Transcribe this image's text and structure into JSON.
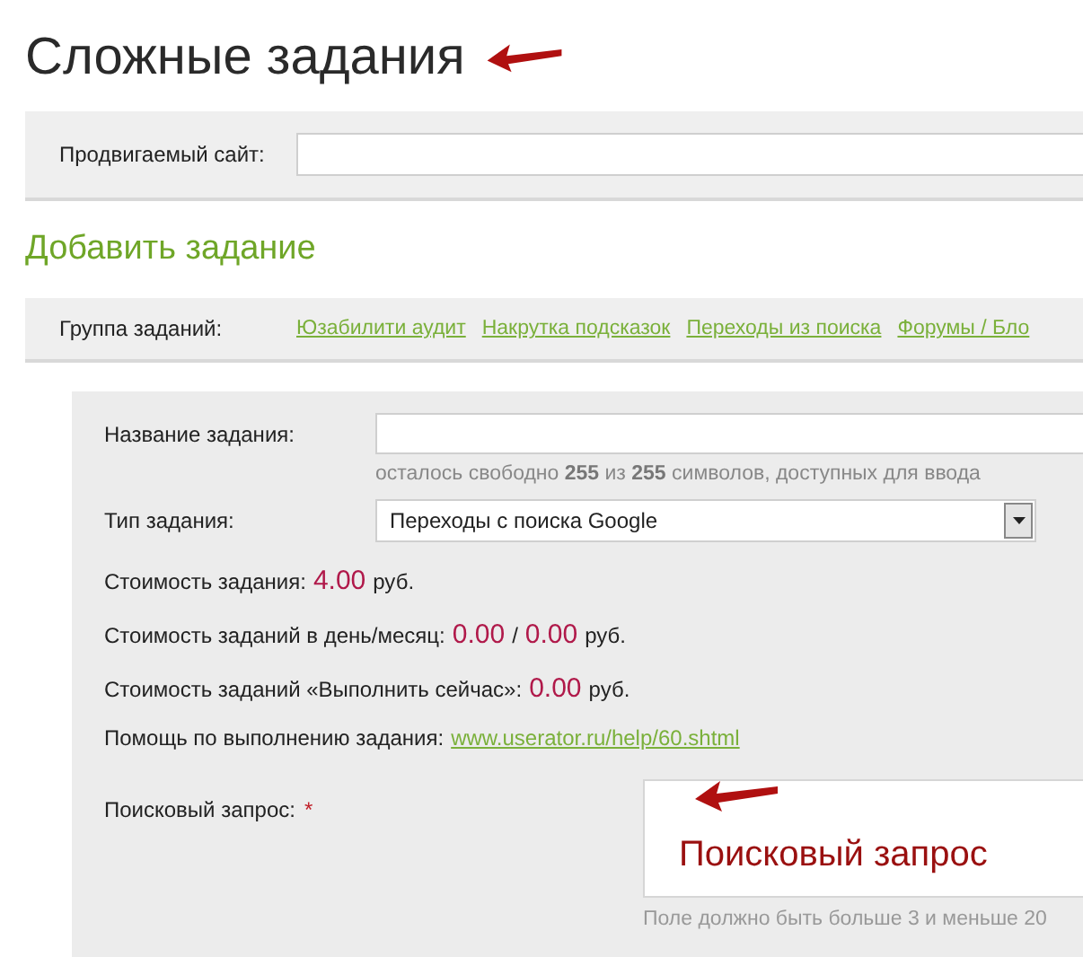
{
  "page_title": "Сложные задания",
  "site_field": {
    "label": "Продвигаемый сайт:"
  },
  "section_title": "Добавить задание",
  "task_groups": {
    "label": "Группа заданий:",
    "links": [
      "Юзабилити аудит",
      "Накрутка подсказок",
      "Переходы из поиска",
      "Форумы / Бло"
    ]
  },
  "name_field": {
    "label": "Название задания:",
    "hint": "осталось свободно **255** из **255** символов, доступных для ввода"
  },
  "type_field": {
    "label": "Тип задания:",
    "value": "Переходы с поиска Google"
  },
  "costs": [
    {
      "label": "Стоимость задания:",
      "values": [
        "4.00"
      ],
      "unit": "руб."
    },
    {
      "label": "Стоимость заданий в день/месяц:",
      "values": [
        "0.00",
        "0.00"
      ],
      "separator": "/",
      "unit": "руб."
    },
    {
      "label": "Стоимость заданий «Выполнить сейчас»:",
      "values": [
        "0.00"
      ],
      "unit": "руб."
    }
  ],
  "help": {
    "label": "Помощь по выполнению задания:",
    "link": "www.userator.ru/help/60.shtml"
  },
  "query_field": {
    "label": "Поисковый запрос:",
    "required_mark": "*",
    "annotation": "Поисковый запрос",
    "hint": "Поле должно быть больше 3 и меньше 20"
  }
}
